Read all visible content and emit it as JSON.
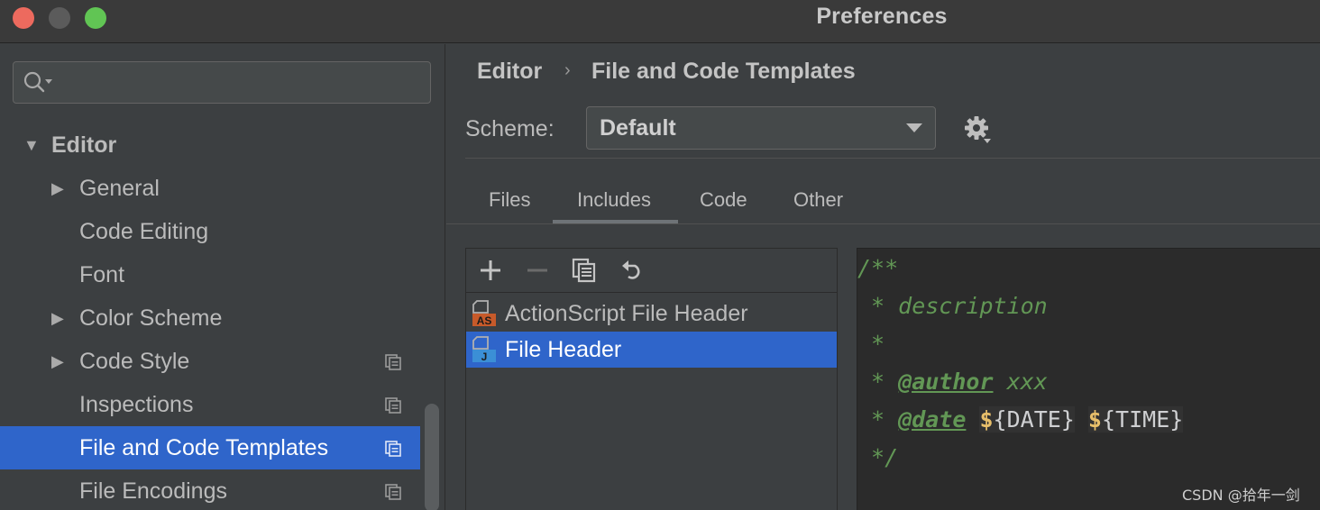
{
  "window": {
    "title": "Preferences"
  },
  "sidebar": {
    "search": {
      "placeholder": ""
    },
    "items": [
      {
        "label": "Editor",
        "level": 0,
        "expanded": true,
        "arrow": "▼",
        "copy": false,
        "selected": false
      },
      {
        "label": "General",
        "level": 1,
        "arrow": "▶",
        "copy": false,
        "selected": false
      },
      {
        "label": "Code Editing",
        "level": 1,
        "arrow": "",
        "copy": false,
        "selected": false
      },
      {
        "label": "Font",
        "level": 1,
        "arrow": "",
        "copy": false,
        "selected": false
      },
      {
        "label": "Color Scheme",
        "level": 1,
        "arrow": "▶",
        "copy": false,
        "selected": false
      },
      {
        "label": "Code Style",
        "level": 1,
        "arrow": "▶",
        "copy": true,
        "selected": false
      },
      {
        "label": "Inspections",
        "level": 1,
        "arrow": "",
        "copy": true,
        "selected": false
      },
      {
        "label": "File and Code Templates",
        "level": 1,
        "arrow": "",
        "copy": true,
        "selected": true
      },
      {
        "label": "File Encodings",
        "level": 1,
        "arrow": "",
        "copy": true,
        "selected": false
      }
    ]
  },
  "breadcrumb": {
    "parent": "Editor",
    "separator": "›",
    "current": "File and Code Templates"
  },
  "scheme": {
    "label": "Scheme:",
    "value": "Default"
  },
  "tabs": [
    {
      "label": "Files",
      "active": false
    },
    {
      "label": "Includes",
      "active": true
    },
    {
      "label": "Code",
      "active": false
    },
    {
      "label": "Other",
      "active": false
    }
  ],
  "toolbar": {
    "add": "plus-icon",
    "remove": "minus-icon",
    "copy": "copy-icon",
    "reset": "undo-icon"
  },
  "templates": [
    {
      "label": "ActionScript File Header",
      "icon_text": "AS",
      "icon_color": "#c75a2a",
      "selected": false
    },
    {
      "label": "File Header",
      "icon_text": "J",
      "icon_color": "#3b8fd6",
      "selected": true
    }
  ],
  "editor": {
    "lines": {
      "l1": "/**",
      "l2": " * description",
      "l3": " *",
      "l4_prefix": " * ",
      "l4_tag": "@author",
      "l4_value": " xxx",
      "l5_prefix": " * ",
      "l5_tag": "@date",
      "l5_space": " ",
      "l5_var1": "{DATE}",
      "l5_var2": "{TIME}",
      "l6": " */"
    },
    "dollar": "$"
  },
  "watermark": "CSDN @拾年一剑",
  "colors": {
    "selection": "#2f65ca",
    "background": "#3c3f41",
    "editor_bg": "#2b2b2b",
    "comment": "#629755"
  }
}
